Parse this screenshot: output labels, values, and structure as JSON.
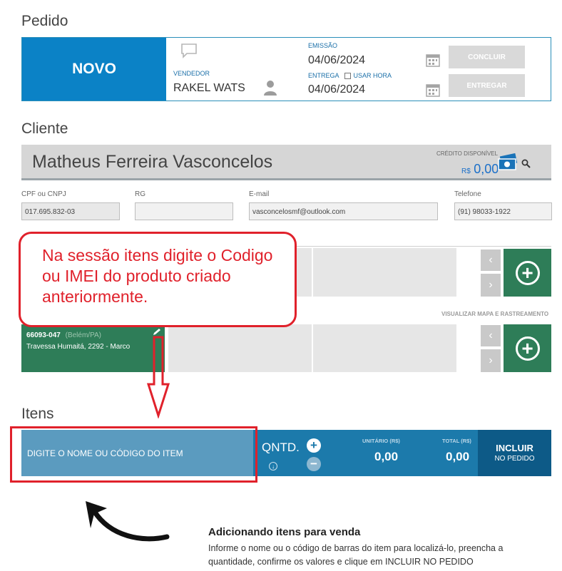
{
  "pedido": {
    "section_title": "Pedido",
    "status": "NOVO",
    "vendedor_label": "VENDEDOR",
    "vendedor": "RAKEL WATS",
    "emissao_label": "EMISSÃO",
    "emissao": "04/06/2024",
    "entrega_label": "ENTREGA",
    "usar_hora_label": "USAR HORA",
    "entrega": "04/06/2024",
    "concluir_label": "CONCLUIR",
    "entregar_label": "ENTREGAR"
  },
  "cliente": {
    "section_title": "Cliente",
    "name": "Matheus Ferreira Vasconcelos",
    "credito_label": "CRÉDITO DISPONÍVEL",
    "credito_currency": "R$",
    "credito_value": "0,00",
    "fields": {
      "cpf_label": "CPF ou CNPJ",
      "cpf": "017.695.832-03",
      "rg_label": "RG",
      "rg": "",
      "email_label": "E-mail",
      "email": "vasconcelosmf@outlook.com",
      "telefone_label": "Telefone",
      "telefone": "(91) 98033-1922"
    },
    "mapa_link": "VISUALIZAR MAPA E RASTREAMENTO",
    "address": {
      "cep": "66093-047",
      "cidade": "(Belém/PA)",
      "rua": "Travessa Humaitá, 2292 - Marco"
    }
  },
  "itens": {
    "section_title": "Itens",
    "input_placeholder": "DIGITE O NOME OU CÓDIGO DO ITEM",
    "qntd_label": "QNTD.",
    "unitario_label": "UNITÁRIO (R$)",
    "unitario_value": "0,00",
    "total_label": "TOTAL (R$)",
    "total_value": "0,00",
    "incluir_label": "INCLUIR",
    "incluir_sub": "NO PEDIDO"
  },
  "annotation": {
    "callout_text": "Na sessão itens digite o Codigo ou IMEI do produto criado anteriormente."
  },
  "footer": {
    "title": "Adicionando itens para venda",
    "text": "Informe o nome ou o código de barras do item para localizá-lo, preencha a quantidade, confirme os valores e clique em INCLUIR NO PEDIDO"
  },
  "colors": {
    "brand_blue": "#0b82c6",
    "green": "#2e7d58",
    "annotation_red": "#e0212b"
  }
}
